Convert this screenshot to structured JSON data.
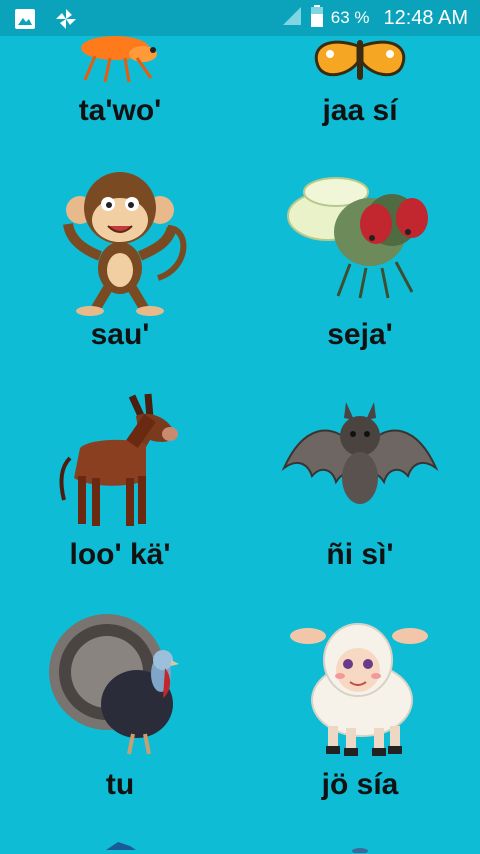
{
  "status_bar": {
    "battery_percent": "63 %",
    "time": "12:48 AM"
  },
  "animals": [
    {
      "label": "ta'wo'",
      "icon": "shrimp-icon"
    },
    {
      "label": "jaa sí",
      "icon": "butterfly-icon"
    },
    {
      "label": "sau'",
      "icon": "monkey-icon"
    },
    {
      "label": "seja'",
      "icon": "fly-icon"
    },
    {
      "label": "loo' kä'",
      "icon": "donkey-icon"
    },
    {
      "label": "ñi sì'",
      "icon": "bat-icon"
    },
    {
      "label": "tu",
      "icon": "turkey-icon"
    },
    {
      "label": "jö sía",
      "icon": "sheep-icon"
    }
  ],
  "colors": {
    "background": "#0fbcd5",
    "status_bar": "#0aa3bb",
    "label_text": "#111111"
  }
}
